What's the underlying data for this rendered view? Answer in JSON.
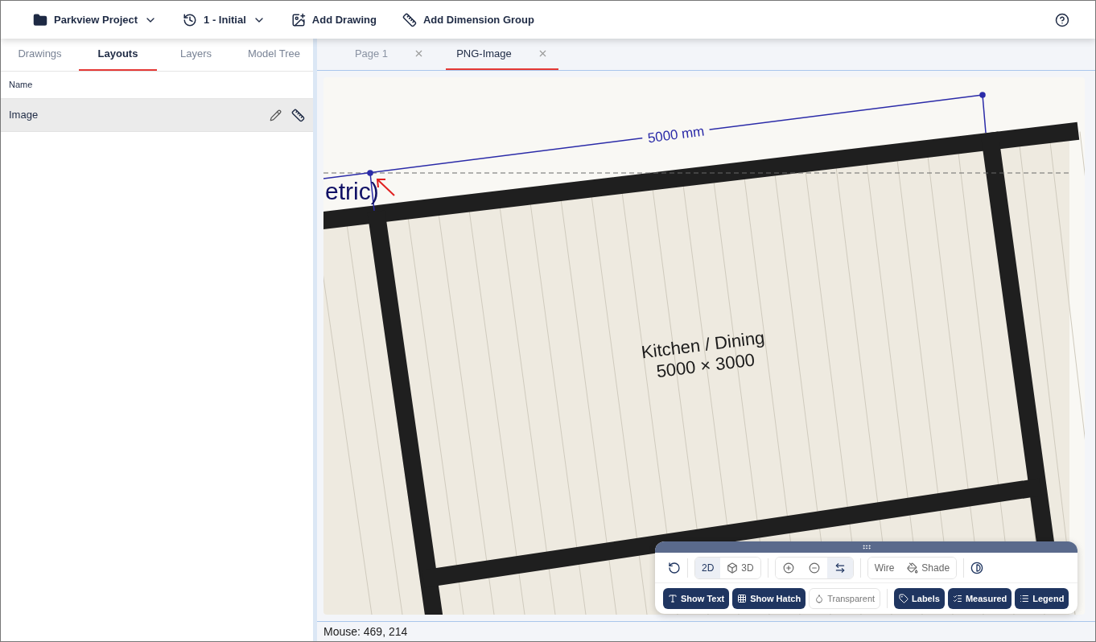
{
  "toolbar": {
    "project": "Parkview Project",
    "version": "1 - Initial",
    "actions": [
      {
        "kind": "drawing",
        "label": "Add Drawing"
      },
      {
        "kind": "dimension",
        "label": "Add Dimension Group"
      }
    ]
  },
  "sidebar": {
    "tabs": [
      {
        "label": "Drawings",
        "selected": false
      },
      {
        "label": "Layouts",
        "selected": true
      },
      {
        "label": "Layers",
        "selected": false
      },
      {
        "label": "Model Tree",
        "selected": false
      }
    ],
    "column": "Name",
    "items": [
      {
        "label": "Image",
        "selected": true
      }
    ]
  },
  "doc_tabs": [
    {
      "label": "Page 1",
      "selected": false
    },
    {
      "label": "PNG-Image",
      "selected": true
    }
  ],
  "drawing": {
    "dimension": "5000 mm",
    "clipped_label": "etric)",
    "room_name": "Kitchen / Dining",
    "room_size": "5000 × 3000"
  },
  "view_controls": {
    "mode": [
      {
        "kind": "flat",
        "label": "2D",
        "selected": true
      },
      {
        "kind": "solid",
        "label": "3D",
        "selected": false
      }
    ],
    "zoom": [
      {
        "kind": "zoom-in",
        "selected": false
      },
      {
        "kind": "zoom-out",
        "selected": false
      },
      {
        "kind": "pan",
        "selected": true
      }
    ],
    "render": [
      {
        "kind": "wire",
        "label": "Wire",
        "selected": false
      },
      {
        "kind": "shade",
        "label": "Shade",
        "selected": false
      }
    ],
    "display": [
      {
        "kind": "text",
        "label": "Show Text",
        "on": true
      },
      {
        "kind": "hatch",
        "label": "Show Hatch",
        "on": true
      },
      {
        "kind": "transparent",
        "label": "Transparent",
        "on": false
      }
    ],
    "overlays": [
      {
        "kind": "labels",
        "label": "Labels",
        "on": true
      },
      {
        "kind": "measured",
        "label": "Measured",
        "on": true
      },
      {
        "kind": "legend",
        "label": "Legend",
        "on": true
      }
    ]
  },
  "status_bar": "Mouse: 469, 214"
}
